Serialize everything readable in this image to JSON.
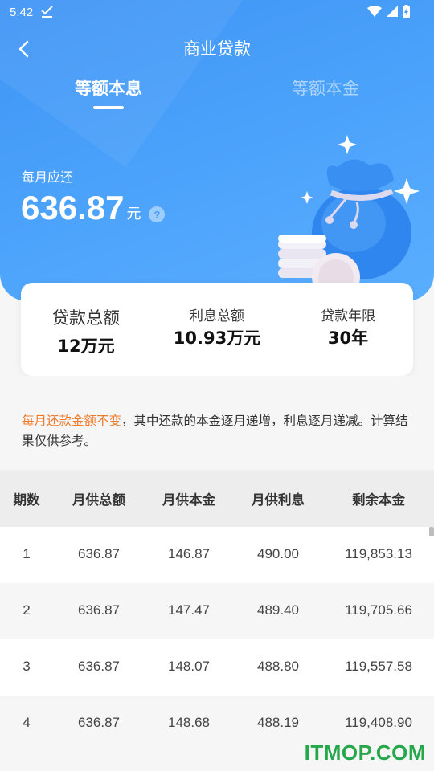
{
  "status_bar": {
    "time": "5:42"
  },
  "header": {
    "title": "商业贷款"
  },
  "tabs": [
    {
      "label": "等额本息",
      "active": true
    },
    {
      "label": "等额本金",
      "active": false
    }
  ],
  "monthly": {
    "label": "每月应还",
    "amount": "636.87",
    "unit": "元",
    "help": "?"
  },
  "summary": {
    "loan_label": "贷款总额",
    "loan_value": "12万元",
    "interest_label": "利息总额",
    "interest_value": "10.93万元",
    "term_label": "贷款年限",
    "term_value": "30年"
  },
  "note": {
    "highlight": "每月还款金额不变",
    "text": "，其中还款的本金逐月递增，利息逐月递减。计算结果仅供参考。"
  },
  "table": {
    "headers": [
      "期数",
      "月供总额",
      "月供本金",
      "月供利息",
      "剩余本金"
    ],
    "rows": [
      [
        "1",
        "636.87",
        "146.87",
        "490.00",
        "119,853.13"
      ],
      [
        "2",
        "636.87",
        "147.47",
        "489.40",
        "119,705.66"
      ],
      [
        "3",
        "636.87",
        "148.07",
        "488.80",
        "119,557.58"
      ],
      [
        "4",
        "636.87",
        "148.68",
        "488.19",
        "119,408.90"
      ]
    ]
  },
  "watermark": "ITMOP.COM",
  "colors": {
    "primary": "#4a9bf8",
    "highlight": "#f07a2a",
    "watermark": "#24a84a"
  }
}
